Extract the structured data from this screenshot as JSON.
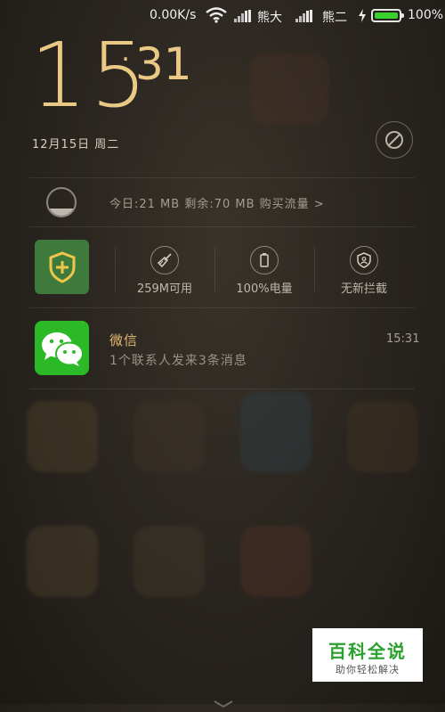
{
  "status_bar": {
    "net_speed": "0.00K/s",
    "carrier1": "熊大",
    "carrier2": "熊二",
    "battery_percent": "100%",
    "battery_level": 1.0,
    "battery_color": "#38d12e",
    "icons": [
      "wifi-icon",
      "signal-icon",
      "charging-icon",
      "battery-icon"
    ]
  },
  "clock": {
    "hour": "15",
    "minute": "31",
    "colon": ":",
    "date": "12月15日 周二",
    "color": "#e9c984"
  },
  "data_usage": {
    "text": "今日:21 MB  剩余:70 MB  购买流量 >"
  },
  "toggles": [
    {
      "label": "259M可用",
      "icon": "broom-icon"
    },
    {
      "label": "100%电量",
      "icon": "battery-icon"
    },
    {
      "label": "无新拦截",
      "icon": "shield-icon"
    }
  ],
  "notification": {
    "app": "微信",
    "time": "15:31",
    "message": "1个联系人发来3条消息",
    "icon": "wechat-icon"
  },
  "watermark": {
    "title": "百科全说",
    "subtitle": "助你轻松解决"
  }
}
